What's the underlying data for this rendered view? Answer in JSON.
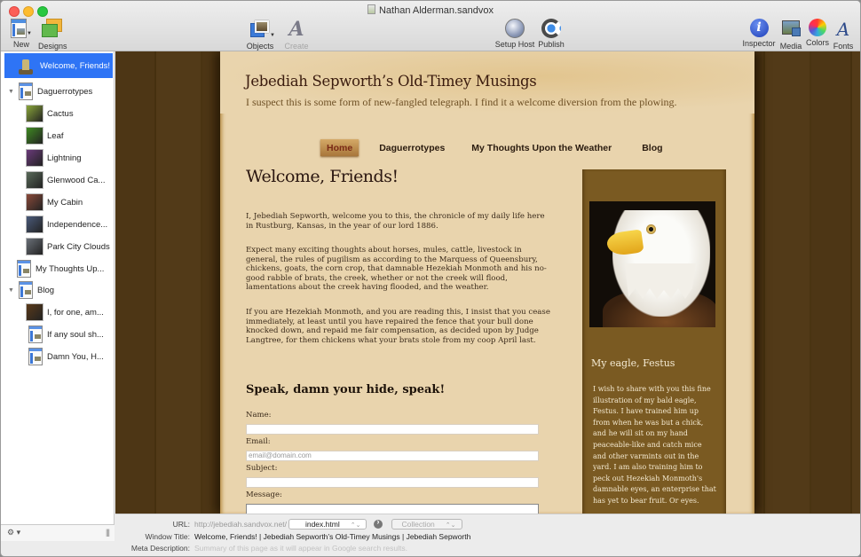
{
  "window": {
    "title": "Nathan Alderman.sandvox"
  },
  "toolbar": {
    "new_label": "New",
    "designs_label": "Designs",
    "objects_label": "Objects",
    "create_link_label": "Create Link",
    "setup_host_label": "Setup Host",
    "publish_label": "Publish",
    "inspector_label": "Inspector",
    "media_label": "Media",
    "colors_label": "Colors",
    "fonts_label": "Fonts",
    "inspector_glyph": "i",
    "fonts_glyph": "A",
    "link_glyph": "A"
  },
  "sidebar": {
    "selected": "Welcome, Friends!",
    "items": [
      {
        "label": "Daguerrotypes",
        "kind": "collection",
        "expanded": true
      },
      {
        "label": "Cactus",
        "kind": "photo",
        "color": "#8aa63a"
      },
      {
        "label": "Leaf",
        "kind": "photo",
        "color": "#3f8a22"
      },
      {
        "label": "Lightning",
        "kind": "photo",
        "color": "#6a3a7a"
      },
      {
        "label": "Glenwood Ca...",
        "kind": "photo",
        "color": "#5a6a5a"
      },
      {
        "label": "My Cabin",
        "kind": "photo",
        "color": "#8a4a3a"
      },
      {
        "label": "Independence...",
        "kind": "photo",
        "color": "#4a5a7a"
      },
      {
        "label": "Park City Clouds",
        "kind": "photo",
        "color": "#6a7078"
      },
      {
        "label": "My Thoughts Up...",
        "kind": "page"
      },
      {
        "label": "Blog",
        "kind": "collection",
        "expanded": true
      },
      {
        "label": "I, for one, am...",
        "kind": "photo",
        "color": "#5a3a1a"
      },
      {
        "label": "If any soul sh...",
        "kind": "page"
      },
      {
        "label": "Damn You, H...",
        "kind": "page"
      }
    ],
    "disclosure_glyph": "▼",
    "gear_glyph": "⚙ ▾",
    "grip_glyph": "|||"
  },
  "site": {
    "title": "Jebediah Sepworth’s Old-Timey Musings",
    "tagline": "I suspect this is some form of new-fangled telegraph. I find it a welcome diversion from the plowing.",
    "nav": [
      {
        "label": "Home",
        "active": true
      },
      {
        "label": "Daguerrotypes",
        "active": false
      },
      {
        "label": "My Thoughts Upon the Weather",
        "active": false
      },
      {
        "label": "Blog",
        "active": false
      }
    ],
    "heading": "Welcome, Friends!",
    "paragraphs": [
      "I, Jebediah Sepworth, welcome you to this, the chronicle of my daily life here in Rustburg, Kansas, in the year of our lord 1886.",
      "Expect many exciting thoughts about horses, mules, cattle, livestock in general, the rules of pugilism as according to the Marquess of Queensbury, chickens, goats, the corn crop, that damnable Hezekiah Monmoth and his no-good rabble of brats, the creek, whether or not the creek will flood, lamentations about the creek having flooded, and the weather.",
      "If you are Hezekiah Monmoth, and you are reading this, I insist that you cease immediately, at least until you have repaired the fence that your bull done knocked down, and repaid me fair compensation, as decided upon by Judge Langtree, for them chickens what your brats stole from my coop April last."
    ],
    "form": {
      "heading": "Speak, damn your hide, speak!",
      "name_label": "Name:",
      "name_value": "",
      "email_label": "Email:",
      "email_placeholder": "email@domain.com",
      "subject_label": "Subject:",
      "subject_value": "",
      "message_label": "Message:",
      "message_value": ""
    },
    "sidebar_box": {
      "title": "My eagle, Festus",
      "text": "I wish to share with you this fine illustration of my bald eagle, Festus. I have trained him up from when he was but a chick, and he will sit on my hand peaceable-like and catch mice and other varmints out in the yard. I am also training him to peck out Hezekiah Monmoth's damnable eyes, an enterprise that has yet to bear fruit. Or eyes."
    }
  },
  "page_info": {
    "url_label": "URL:",
    "url_base": "http://jebediah.sandvox.net/",
    "url_file": "index.html",
    "collection_label": "Collection",
    "window_title_label": "Window Title:",
    "window_title_value": "Welcome, Friends! | Jebediah Sepworth’s Old-Timey Musings | Jebediah Sepworth",
    "meta_label": "Meta Description:",
    "meta_placeholder": "Summary of this page as it will appear in Google search results.",
    "popup_arrow": "⌃⌄"
  }
}
